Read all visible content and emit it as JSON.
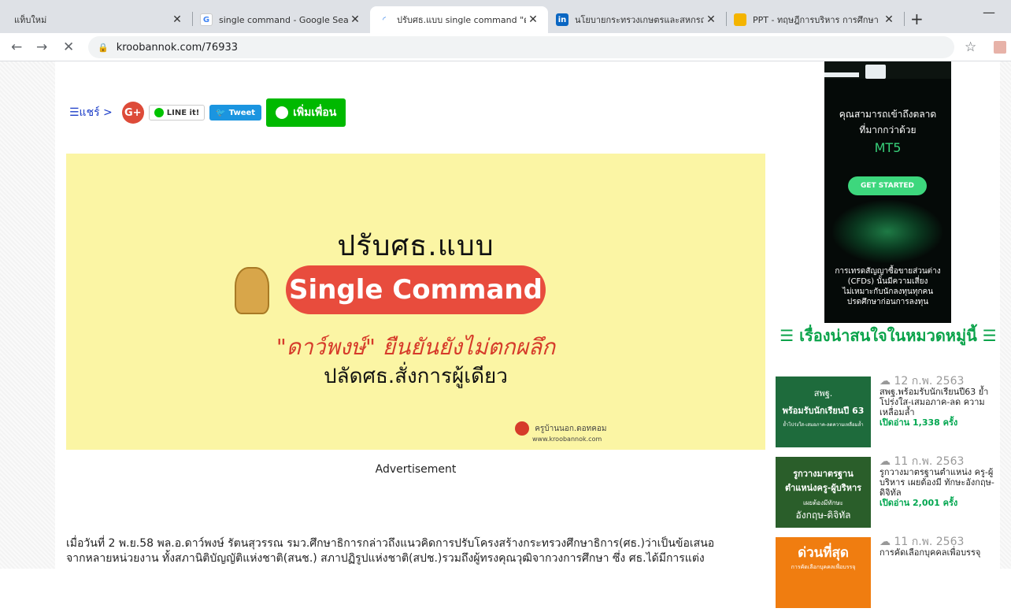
{
  "tabs": [
    {
      "title": "แท็บใหม่"
    },
    {
      "title": "single command - Google Sea"
    },
    {
      "title": "ปรับศธ.แบบ single command \"ด"
    },
    {
      "title": "นโยบายกระทรวงเกษตรและสหกรณ์"
    },
    {
      "title": "PPT - ทฤษฎีการบริหาร การศึกษา"
    }
  ],
  "close_glyph": "✕",
  "tab_icons": [
    "google-icon",
    "loading-icon",
    "linkedin-icon",
    "slides-icon"
  ],
  "new_tab": "+",
  "minimize": "—",
  "url": "kroobannok.com/76933",
  "share": {
    "label": "☰แชร์ >",
    "gplus": "G+",
    "line_it": "LINE it!",
    "tweet": "Tweet",
    "add_friend": "เพิ่มเพื่อน"
  },
  "banner": {
    "line1": "ปรับศธ.แบบ",
    "pill": "Single Command",
    "line3": "\"ดาว์พงษ์\" ยืนยันยังไม่ตกผลึก",
    "line4": "ปลัดศธ.สั่งการผู้เดียว",
    "logo": "ครูบ้านนอก.ดอทคอม",
    "logo_url": "www.kroobannok.com"
  },
  "advertisement": "Advertisement",
  "article": [
    "เมื่อวันที่ 2 พ.ย.58 พล.อ.ดาว์พงษ์ รัตนสุวรรณ รมว.ศึกษาธิการกล่าวถึงแนวคิดการปรับโครงสร้างกระทรวงศึกษาธิการ(ศธ.)ว่าเป็นข้อเสนอ",
    "จากหลายหน่วยงาน ทั้งสภานิติบัญญัติแห่งชาติ(สนช.) สภาปฏิรูปแห่งชาติ(สปช.)รวมถึงผู้ทรงคุณวุฒิจากวงการศึกษา ซึ่ง ศธ.ได้มีการแต่ง"
  ],
  "side_ad": {
    "headline1": "คุณสามารถเข้าถึงตลาด",
    "headline2": "ที่มากกว่าด้วย",
    "product": "MT5",
    "button": "GET STARTED",
    "disclaimer": [
      "การเทรดสัญญาซื้อขายส่วนต่าง",
      "(CFDs) นั้นมีความเสี่ยง",
      "ไม่เหมาะกับนักลงทุนทุกคน",
      "ปรดศึกษาก่อนการลงทุน"
    ]
  },
  "sidebar": {
    "heading": "☰ เรื่องน่าสนใจในหมวดหมู่นี้ ☰",
    "items": [
      {
        "thumb_lines": [
          "สพฐ.",
          "พร้อมรับนักเรียนปี 63",
          "ย้ำโปร่งใส-เสมอภาค-ลดความเหลื่อมล้ำ"
        ],
        "thumb_bg": "#1e6b3c",
        "date": "12 ก.พ. 2563",
        "title": "สพฐ.พร้อมรับนักเรียนปี63 ย้ำโปร่งใส-เสมอภาค-ลด ความเหลื่อมล้ำ",
        "views": "เปิดอ่าน 1,338 ครั้ง"
      },
      {
        "thumb_lines": [
          "รูกวางมาตรฐาน",
          "ตำแหน่งครู-ผู้บริหาร",
          "เผยต้องมีทักษะ",
          "อังกฤษ-ดิจิทัล"
        ],
        "thumb_bg": "#2a5e2a",
        "date": "11 ก.พ. 2563",
        "title": "รูกวางมาตรฐานตำแหน่ง ครู-ผู้บริหาร เผยต้องมี ทักษะอังกฤษ-ดิจิทัล",
        "views": "เปิดอ่าน 2,001 ครั้ง"
      },
      {
        "thumb_lines": [
          "ด่วนที่สุด",
          "การคัดเลือกบุคคลเพื่อบรรจุ"
        ],
        "thumb_bg": "#f07d10",
        "date": "11 ก.พ. 2563",
        "title": "การคัดเลือกบุคคลเพื่อบรรจุ",
        "views": ""
      }
    ]
  }
}
